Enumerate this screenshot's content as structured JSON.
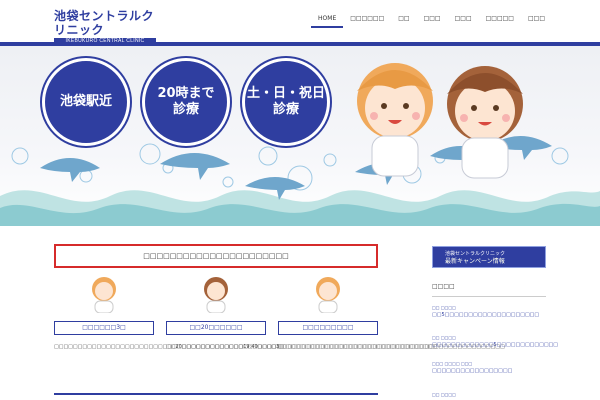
{
  "header": {
    "logo_jp": "池袋セントラルクリニック",
    "logo_en": "IKEBUKURO CENTRAL CLINIC",
    "nav": [
      "HOME",
      "□□□□□□",
      "□□",
      "□□□",
      "□□□",
      "□□□□□",
      "□□□"
    ]
  },
  "hero": {
    "circles": [
      {
        "line1": "池袋駅近",
        "line2": ""
      },
      {
        "line1": "20時まで",
        "line2": "診療"
      },
      {
        "line1": "土・日・祝日",
        "line2": "診療"
      }
    ]
  },
  "main": {
    "banner": "□□□□□□□□□□□□□□□□□□□□□□",
    "features": [
      {
        "title": "□□□□□□3□",
        "text": "□□□□□□□□□□□□□□□□□□□□□□□□□□□□□□□□□□□□□□□□□□□□□□□3□"
      },
      {
        "title": "□□20□□□□□□",
        "text": "□□20□□□□□□□□□□□□□19:40□□□□□□□□□□□□□□□□□□□□□□□□□□□□□□□□□□□□□□"
      },
      {
        "title": "□□□□□□□□□",
        "text": "□□□□□□□□□□□□□□□□□□□□□□□□□□□□□□□□□□□□□□□□□□□□□□□□"
      }
    ]
  },
  "side": {
    "campaign_small": "池袋セントラルクリニック",
    "campaign_big": "最新キャンペーン情報",
    "title": "□□□□",
    "news": [
      {
        "date": "□□ □□□□",
        "title": "□□5□□□□□□□□□□□□□□□□□□□□"
      },
      {
        "date": "□□ □□□□",
        "title": "□□□□□□□□□□□□□5□□□□□□□□□□□□□"
      },
      {
        "date": "□□□ □□□□ □□□",
        "title": "□□□□□□□□□□□□□□□□□"
      },
      {
        "date": "□□ □□□□",
        "title": ""
      }
    ]
  },
  "colors": {
    "brand": "#2f3ea0",
    "banner_border": "#d62b2b",
    "sea": "#6fb3d8"
  }
}
